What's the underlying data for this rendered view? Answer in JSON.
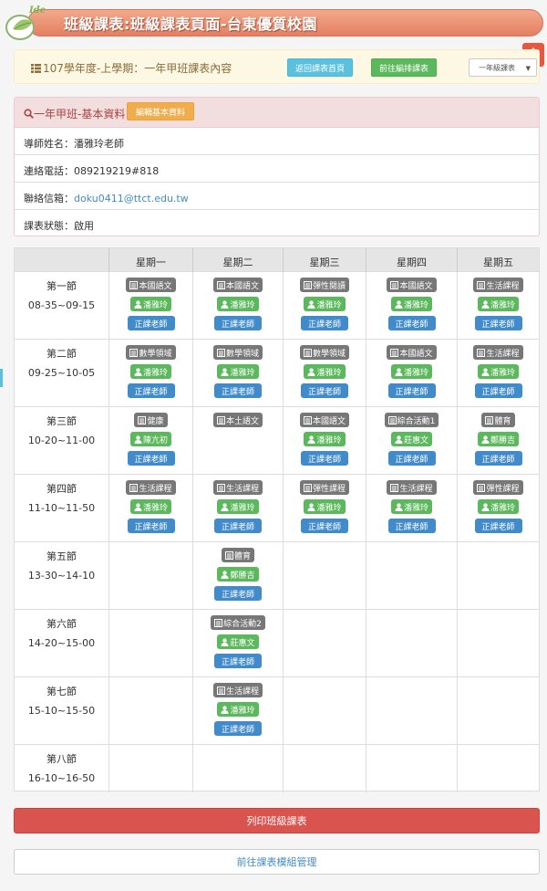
{
  "header": {
    "logo_text": "Idea",
    "title": "班級課表:班級課表頁面-台東優質校園"
  },
  "infobar": {
    "text": "107學年度-上學期：一年甲班課表內容",
    "back_button": "返回課表首頁",
    "edit_button": "前往編排課表",
    "grade_select": "一年級課表"
  },
  "basic": {
    "title": "一年甲班-基本資料",
    "edit_button": "編輯基本資料",
    "teacher": "導師姓名：潘雅玲老師",
    "phone": "連絡電話：089219219#818",
    "email_label": "聯絡信箱：",
    "email": "doku0411@ttct.edu.tw",
    "status": "課表狀態：啟用"
  },
  "timetable": {
    "days": [
      "星期一",
      "星期二",
      "星期三",
      "星期四",
      "星期五"
    ],
    "role_label": "正課老師",
    "periods": [
      {
        "name": "第一節",
        "time": "08-35~09-15",
        "classes": [
          {
            "subject": "本國語文",
            "teacher": "潘雅玲"
          },
          {
            "subject": "本國語文",
            "teacher": "潘雅玲"
          },
          {
            "subject": "彈性閱讀",
            "teacher": "潘雅玲"
          },
          {
            "subject": "本國語文",
            "teacher": "潘雅玲"
          },
          {
            "subject": "生活課程",
            "teacher": "潘雅玲"
          }
        ]
      },
      {
        "name": "第二節",
        "time": "09-25~10-05",
        "classes": [
          {
            "subject": "數學領域",
            "teacher": "潘雅玲"
          },
          {
            "subject": "數學領域",
            "teacher": "潘雅玲"
          },
          {
            "subject": "數學領域",
            "teacher": "潘雅玲"
          },
          {
            "subject": "本國語文",
            "teacher": "潘雅玲"
          },
          {
            "subject": "生活課程",
            "teacher": "潘雅玲"
          }
        ]
      },
      {
        "name": "第三節",
        "time": "10-20~11-00",
        "classes": [
          {
            "subject": "健康",
            "teacher": "陳亢初"
          },
          {
            "subject": "本土語文",
            "teacher": ""
          },
          {
            "subject": "本國語文",
            "teacher": "潘雅玲"
          },
          {
            "subject": "綜合活動1",
            "teacher": "莊惠文"
          },
          {
            "subject": "體育",
            "teacher": "鄭勝吉"
          }
        ]
      },
      {
        "name": "第四節",
        "time": "11-10~11-50",
        "classes": [
          {
            "subject": "生活課程",
            "teacher": "潘雅玲"
          },
          {
            "subject": "生活課程",
            "teacher": "潘雅玲"
          },
          {
            "subject": "彈性課程",
            "teacher": "潘雅玲"
          },
          {
            "subject": "生活課程",
            "teacher": "潘雅玲"
          },
          {
            "subject": "彈性課程",
            "teacher": "潘雅玲"
          }
        ]
      },
      {
        "name": "第五節",
        "time": "13-30~14-10",
        "classes": [
          null,
          {
            "subject": "體育",
            "teacher": "鄭勝吉"
          },
          null,
          null,
          null
        ]
      },
      {
        "name": "第六節",
        "time": "14-20~15-00",
        "classes": [
          null,
          {
            "subject": "綜合活動2",
            "teacher": "莊惠文"
          },
          null,
          null,
          null
        ]
      },
      {
        "name": "第七節",
        "time": "15-10~15-50",
        "classes": [
          null,
          {
            "subject": "生活課程",
            "teacher": "潘雅玲"
          },
          null,
          null,
          null
        ]
      },
      {
        "name": "第八節",
        "time": "16-10~16-50",
        "classes": [
          null,
          null,
          null,
          null,
          null
        ]
      }
    ]
  },
  "footer": {
    "print_button": "列印班級課表",
    "module_button": "前往課表模組管理"
  },
  "colors": {
    "banner": "#e47f62",
    "danger": "#d9534f",
    "primary": "#428bca",
    "success": "#5cb85c",
    "label_default": "#777777"
  }
}
